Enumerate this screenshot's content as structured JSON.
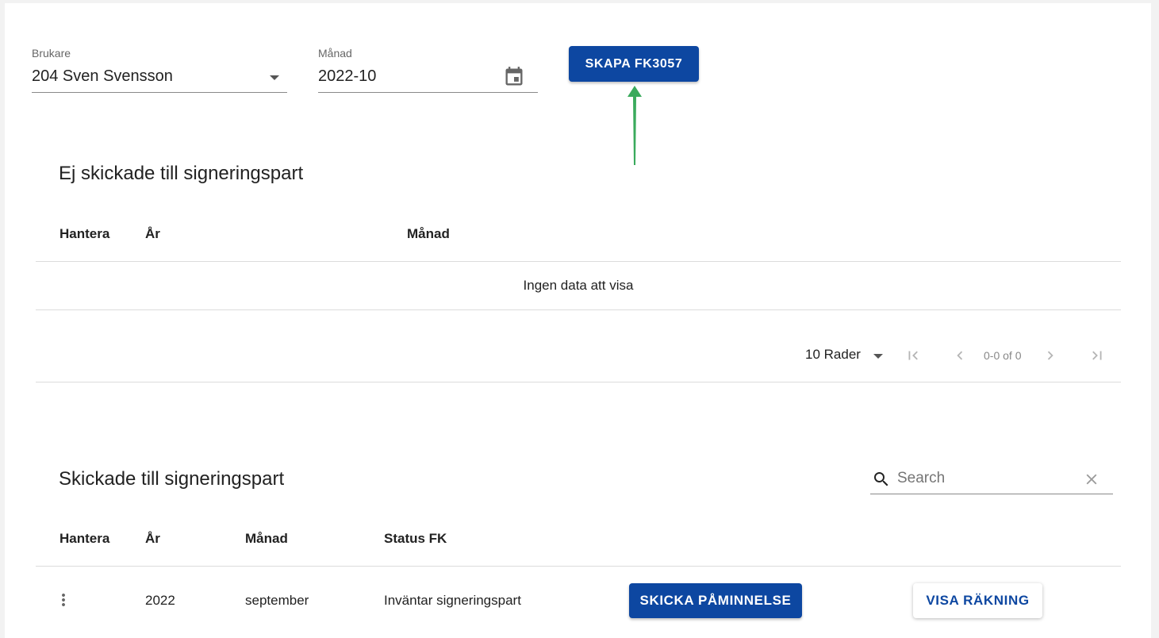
{
  "filters": {
    "brukare": {
      "label": "Brukare",
      "value": "204 Sven Svensson"
    },
    "manad": {
      "label": "Månad",
      "value": "2022-10"
    },
    "create_button": "SKAPA FK3057"
  },
  "section_unsent": {
    "title": "Ej skickade till signeringspart",
    "columns": [
      "Hantera",
      "År",
      "Månad"
    ],
    "empty_text": "Ingen data att visa",
    "pagination": {
      "rows_label": "10 Rader",
      "range": "0-0 of 0"
    }
  },
  "section_sent": {
    "title": "Skickade till signeringspart",
    "search": {
      "placeholder": "Search"
    },
    "columns": [
      "Hantera",
      "År",
      "Månad",
      "Status FK"
    ],
    "rows": [
      {
        "year": "2022",
        "month": "september",
        "status": "Inväntar signeringspart",
        "reminder_button": "SKICKA PÅMINNELSE",
        "invoice_button": "VISA RÄKNING"
      }
    ]
  },
  "colors": {
    "primary": "#0d47a1",
    "annotation_arrow": "#3aaa5c"
  },
  "icons": {
    "calendar": "calendar-icon",
    "dropdown": "dropdown-caret-icon",
    "search": "search-icon",
    "clear": "close-icon",
    "more": "more-vert-icon",
    "first": "first-page-icon",
    "prev": "chevron-left-icon",
    "next": "chevron-right-icon",
    "last": "last-page-icon"
  }
}
